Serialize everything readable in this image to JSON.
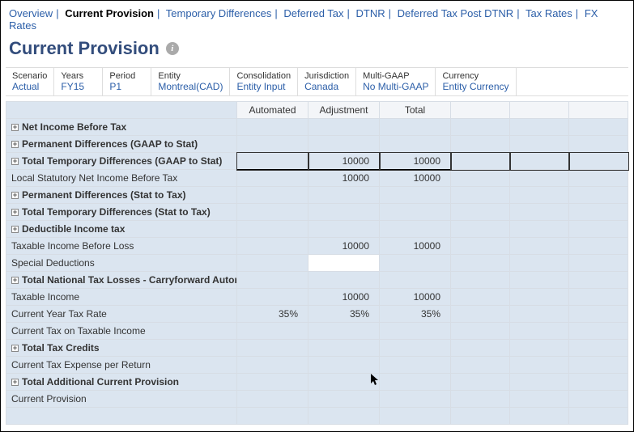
{
  "breadcrumb": [
    {
      "label": "Overview",
      "active": false
    },
    {
      "label": "Current Provision",
      "active": true
    },
    {
      "label": "Temporary Differences",
      "active": false
    },
    {
      "label": "Deferred Tax",
      "active": false
    },
    {
      "label": "DTNR",
      "active": false
    },
    {
      "label": "Deferred Tax Post DTNR",
      "active": false
    },
    {
      "label": "Tax Rates",
      "active": false
    },
    {
      "label": "FX Rates",
      "active": false
    }
  ],
  "page_title": "Current Provision",
  "pov": {
    "scenario": {
      "label": "Scenario",
      "value": "Actual"
    },
    "years": {
      "label": "Years",
      "value": "FY15"
    },
    "period": {
      "label": "Period",
      "value": "P1"
    },
    "entity": {
      "label": "Entity",
      "value": "Montreal(CAD)"
    },
    "consolidation": {
      "label": "Consolidation",
      "value": "Entity Input"
    },
    "jurisdiction": {
      "label": "Jurisdiction",
      "value": "Canada"
    },
    "multigaap": {
      "label": "Multi-GAAP",
      "value": "No Multi-GAAP"
    },
    "currency": {
      "label": "Currency",
      "value": "Entity Currency"
    }
  },
  "columns": {
    "automated": "Automated",
    "adjustment": "Adjustment",
    "total": "Total"
  },
  "rows": {
    "net_income_before_tax": {
      "label": "Net Income Before Tax",
      "expand": true,
      "bold": true
    },
    "perm_diff_gaap": {
      "label": "Permanent Differences (GAAP to Stat)",
      "expand": true,
      "bold": true
    },
    "total_temp_diff_gaap": {
      "label": "Total Temporary Differences (GAAP to Stat)",
      "expand": true,
      "bold": true,
      "adjustment": "10000",
      "total": "10000",
      "selected": true
    },
    "local_stat_net": {
      "label": "Local Statutory Net Income Before Tax",
      "adjustment": "10000",
      "total": "10000"
    },
    "perm_diff_stat": {
      "label": "Permanent Differences (Stat to Tax)",
      "expand": true,
      "bold": true
    },
    "total_temp_diff_stat": {
      "label": "Total Temporary Differences (Stat to Tax)",
      "expand": true,
      "bold": true
    },
    "deductible_income_tax": {
      "label": "Deductible Income tax",
      "expand": true,
      "bold": true
    },
    "taxable_income_before_loss": {
      "label": "Taxable Income Before Loss",
      "adjustment": "10000",
      "total": "10000"
    },
    "special_deductions": {
      "label": "Special Deductions",
      "editable_adj": true
    },
    "total_national_tax_losses": {
      "label": "Total National Tax Losses - Carryforward Automated",
      "expand": true,
      "bold": true
    },
    "taxable_income": {
      "label": "Taxable Income",
      "adjustment": "10000",
      "total": "10000"
    },
    "current_year_tax_rate": {
      "label": "Current Year Tax Rate",
      "automated": "35%",
      "adjustment": "35%",
      "total": "35%"
    },
    "current_tax_on_taxable": {
      "label": "Current Tax on Taxable Income"
    },
    "total_tax_credits": {
      "label": "Total Tax Credits",
      "expand": true,
      "bold": true
    },
    "current_tax_expense_return": {
      "label": "Current Tax Expense per Return"
    },
    "total_additional_current": {
      "label": "Total Additional Current Provision",
      "expand": true,
      "bold": true
    },
    "current_provision": {
      "label": "Current Provision"
    }
  }
}
